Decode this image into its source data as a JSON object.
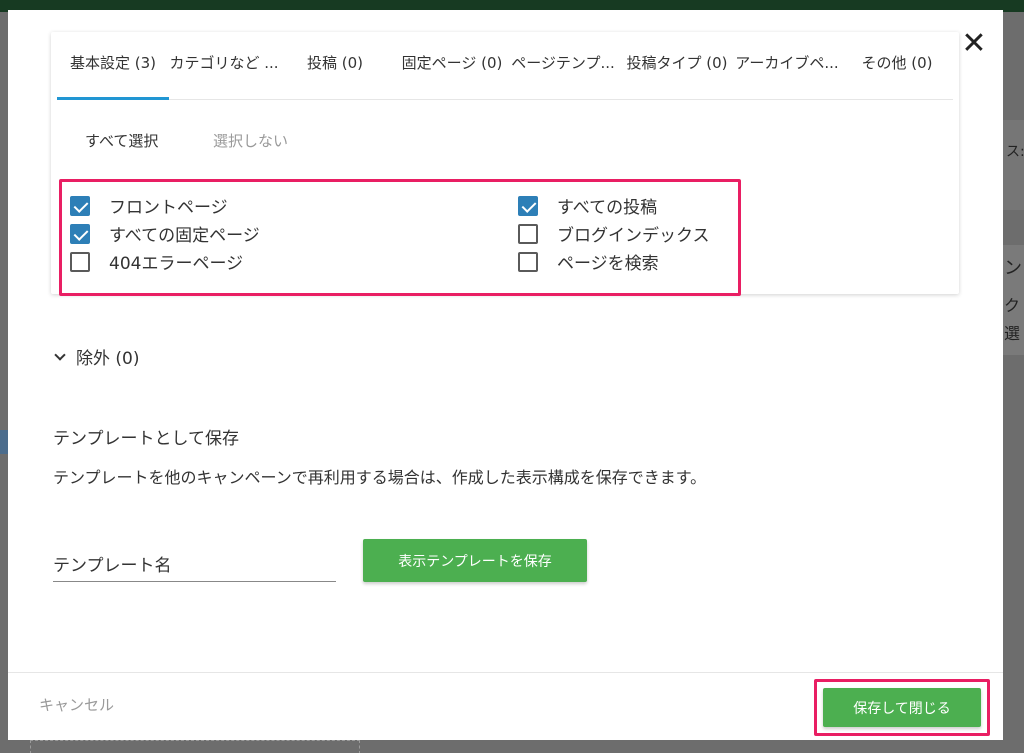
{
  "modal": {
    "tabs": [
      {
        "label": "基本設定 (3)"
      },
      {
        "label": "カテゴリなど ..."
      },
      {
        "label": "投稿 (0)"
      },
      {
        "label": "固定ページ (0)"
      },
      {
        "label": "ページテンプ..."
      },
      {
        "label": "投稿タイプ (0)"
      },
      {
        "label": "アーカイブペ..."
      },
      {
        "label": "その他 (0)"
      }
    ],
    "select_all_label": "すべて選択",
    "select_none_label": "選択しない",
    "checkboxes": [
      {
        "label": "フロントページ",
        "checked": true
      },
      {
        "label": "すべての固定ページ",
        "checked": true
      },
      {
        "label": "404エラーページ",
        "checked": false
      },
      {
        "label": "すべての投稿",
        "checked": true
      },
      {
        "label": "ブログインデックス",
        "checked": false
      },
      {
        "label": "ページを検索",
        "checked": false
      }
    ],
    "exclude_label": "除外 (0)",
    "template": {
      "heading": "テンプレートとして保存",
      "description": "テンプレートを他のキャンペーンで再利用する場合は、作成した表示構成を保存できます。",
      "name_placeholder": "テンプレート名",
      "save_template_label": "表示テンプレートを保存"
    },
    "footer": {
      "cancel_label": "キャンセル",
      "save_close_label": "保存して閉じる"
    },
    "close_icon": "close-icon"
  },
  "background": {
    "text1": "ス:",
    "text2": "ン",
    "text3": "ク",
    "text4": "選"
  },
  "colors": {
    "accent_tab": "#2196d3",
    "highlight": "#e91e63",
    "button_green": "#4caf50",
    "checkbox_checked": "#2d7fb7"
  }
}
